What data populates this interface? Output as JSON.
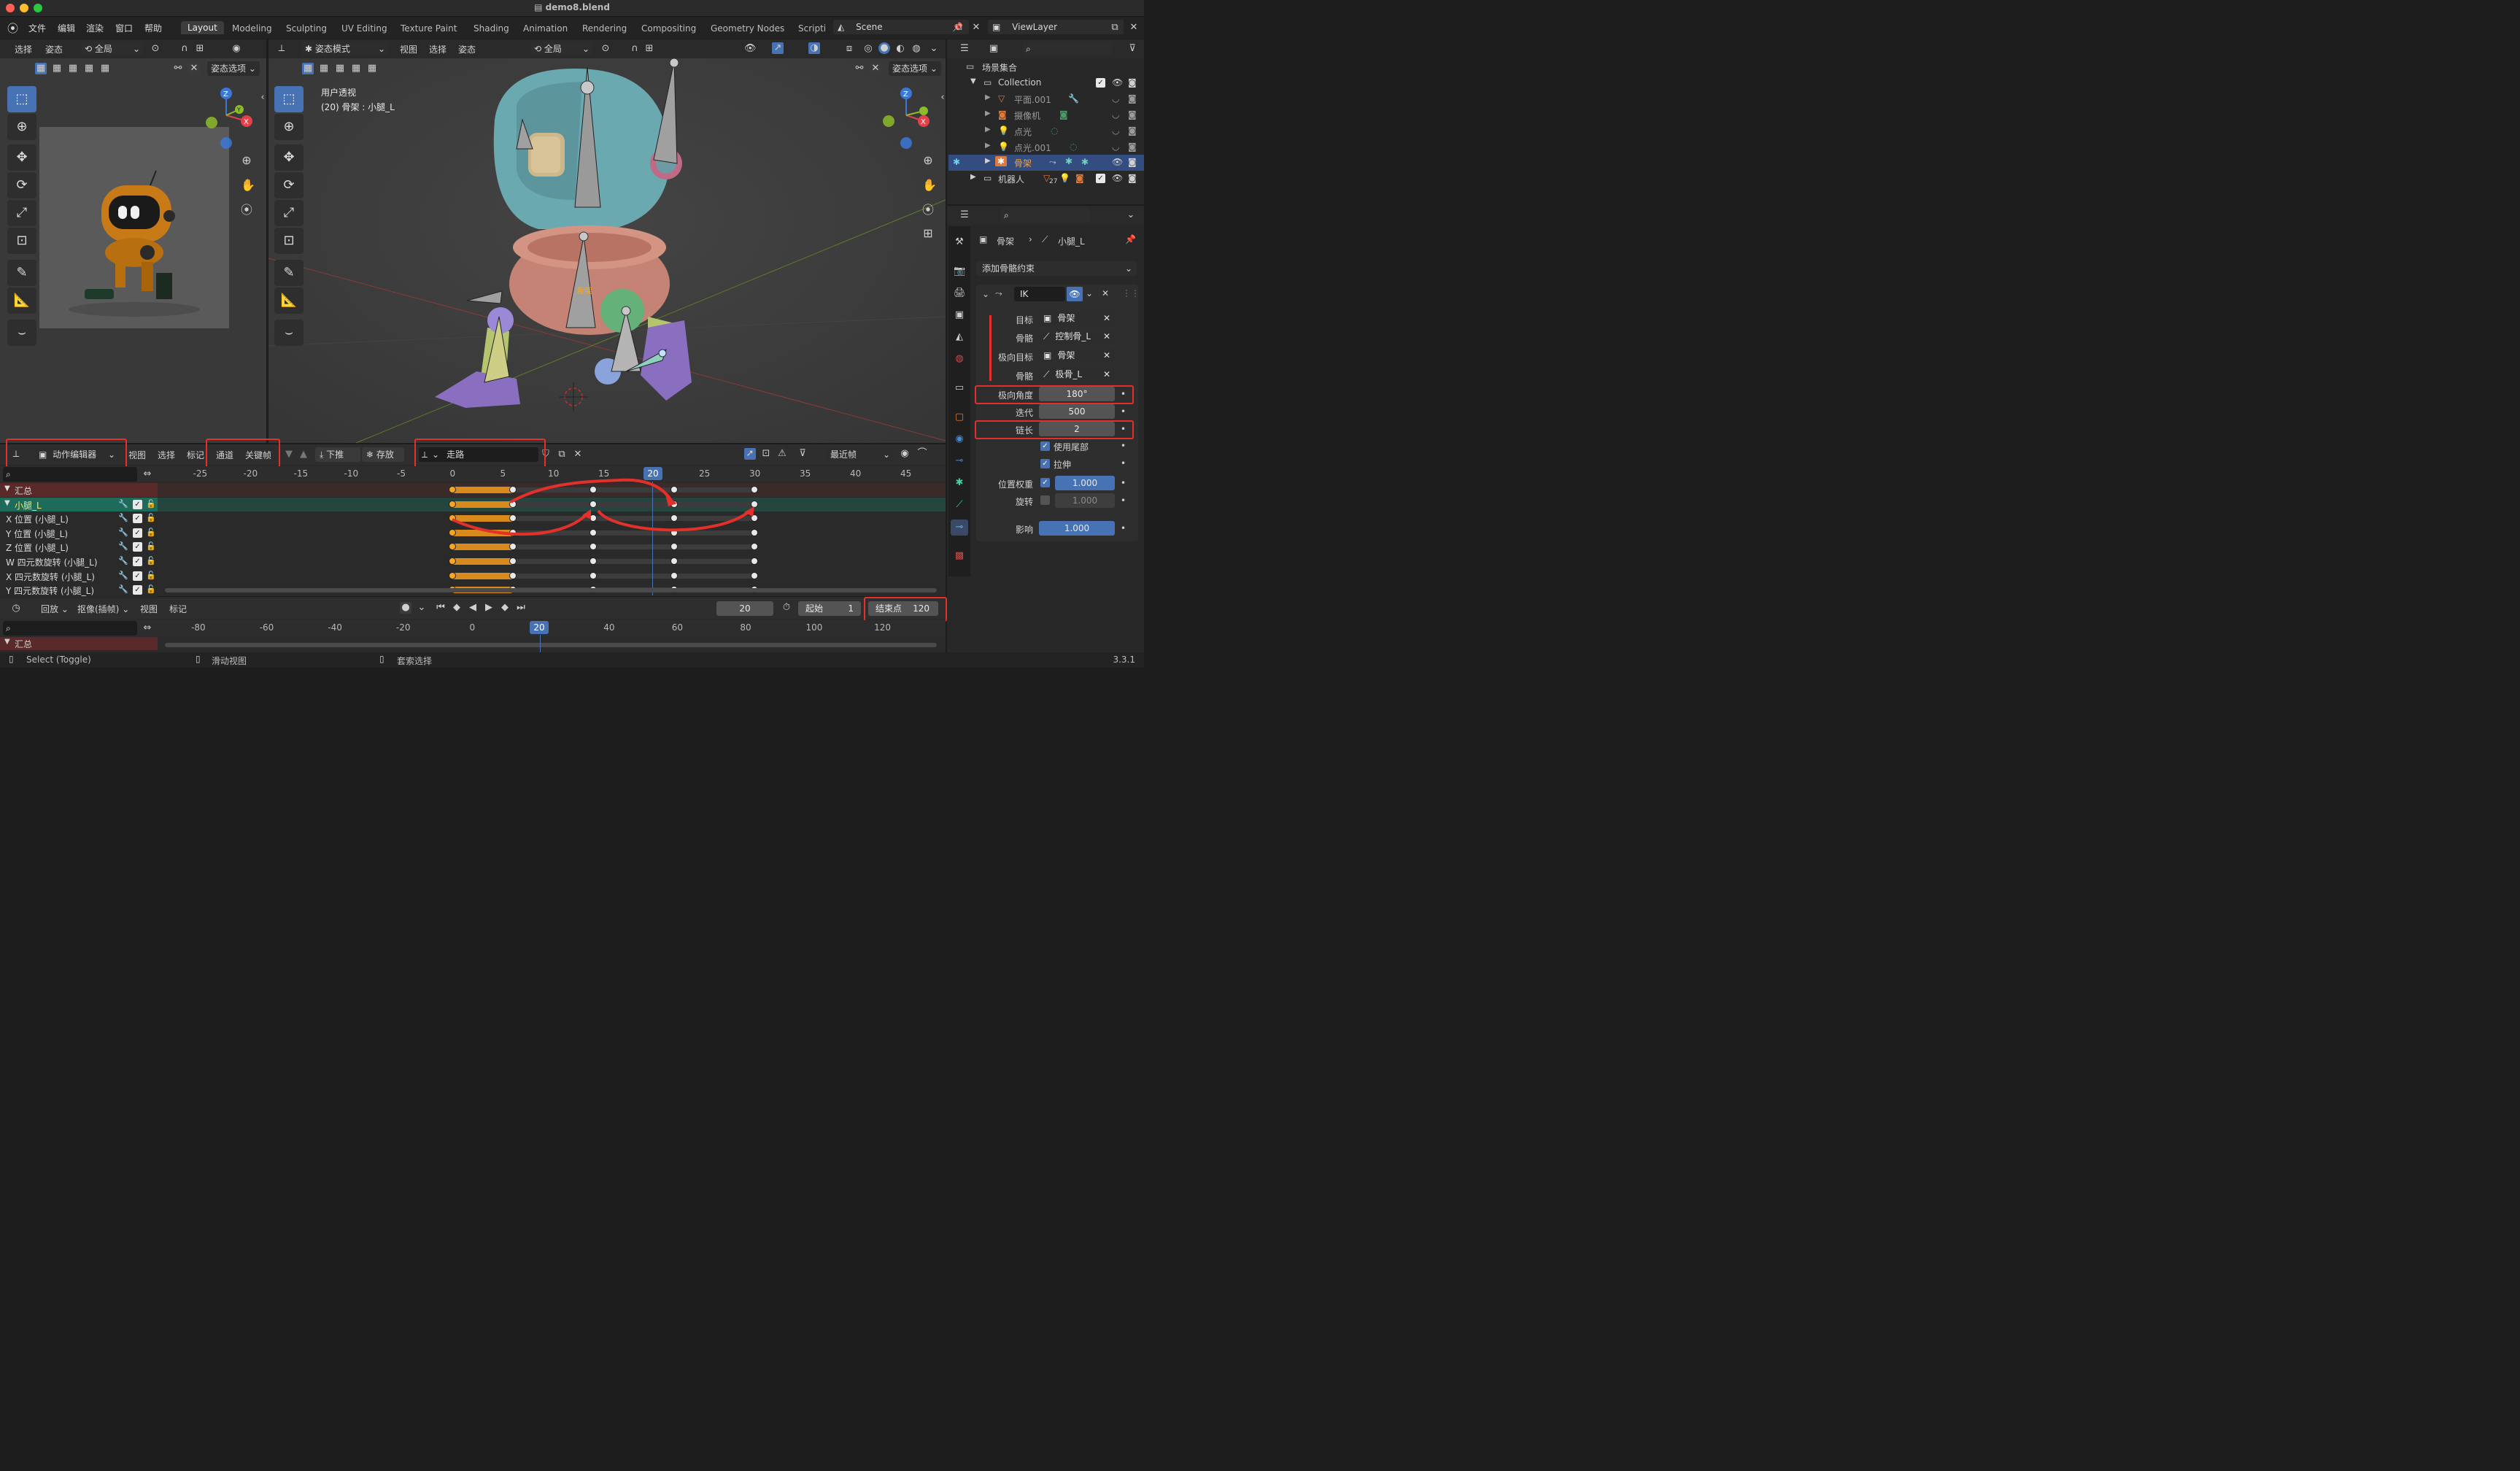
{
  "window": {
    "title": "demo8.blend",
    "version": "3.3.1"
  },
  "menu": {
    "items": [
      "文件",
      "编辑",
      "渲染",
      "窗口",
      "帮助"
    ]
  },
  "workspaces": [
    "Layout",
    "Modeling",
    "Sculpting",
    "UV Editing",
    "Texture Paint",
    "Shading",
    "Animation",
    "Rendering",
    "Compositing",
    "Geometry Nodes",
    "Scripti"
  ],
  "scene": {
    "name": "Scene",
    "view_layer": "ViewLayer"
  },
  "left_viewport": {
    "menus": [
      "选择",
      "姿态"
    ],
    "transform": "全局",
    "options": "姿态选项"
  },
  "main_viewport": {
    "mode": "姿态模式",
    "menus": [
      "视图",
      "选择",
      "姿态"
    ],
    "transform": "全局",
    "options": "姿态选项",
    "overlay_title": "用户透视",
    "overlay_subtitle": "(20) 骨架 : 小腿_L",
    "object_label": "骨架"
  },
  "outliner": {
    "root": "场景集合",
    "items": [
      {
        "name": "Collection",
        "level": 1
      },
      {
        "name": "平面.001",
        "level": 2
      },
      {
        "name": "摄像机",
        "level": 2
      },
      {
        "name": "点光",
        "level": 2
      },
      {
        "name": "点光.001",
        "level": 2
      },
      {
        "name": "骨架",
        "level": 2,
        "selected": true
      },
      {
        "name": "机器人",
        "level": 1,
        "badge": "27"
      }
    ]
  },
  "properties": {
    "breadcrumb_object": "骨架",
    "breadcrumb_bone": "小腿_L",
    "add_constraint": "添加骨骼约束",
    "constraint_name": "IK",
    "target_label": "目标",
    "target_value": "骨架",
    "bone_label": "骨骼",
    "bone_value": "控制骨_L",
    "pole_target_label": "极向目标",
    "pole_target_value": "骨架",
    "pole_bone_label": "骨骼",
    "pole_bone_value": "极骨_L",
    "pole_angle_label": "极向角度",
    "pole_angle_value": "180°",
    "iterations_label": "迭代",
    "iterations_value": "500",
    "chain_label": "链长",
    "chain_value": "2",
    "use_tail": "使用尾部",
    "stretch": "拉伸",
    "weight_pos_label": "位置权重",
    "weight_pos_value": "1.000",
    "rotation_label": "旋转",
    "rotation_value": "1.000",
    "influence_label": "影响",
    "influence_value": "1.000"
  },
  "dopesheet": {
    "mode": "动作编辑器",
    "menus": [
      "视图",
      "选择",
      "标记"
    ],
    "menus2": [
      "通道",
      "关键帧"
    ],
    "push_down": "下推",
    "stash": "存放",
    "action": "走路",
    "snap": "最近帧",
    "ruler": [
      "-25",
      "-20",
      "-15",
      "-10",
      "-5",
      "0",
      "5",
      "10",
      "15",
      "20",
      "25",
      "30",
      "35",
      "40",
      "45"
    ],
    "current_frame": "20",
    "channels": [
      "汇总",
      "小腿_L",
      "X 位置 (小腿_L)",
      "Y 位置 (小腿_L)",
      "Z 位置 (小腿_L)",
      "W 四元数旋转 (小腿_L)",
      "X 四元数旋转 (小腿_L)",
      "Y 四元数旋转 (小腿_L)"
    ],
    "keyframes": [
      0,
      6,
      14,
      22,
      30
    ]
  },
  "timeline": {
    "playback": "回放",
    "keying": "抠像(插帧)",
    "menus": [
      "视图",
      "标记"
    ],
    "current": "20",
    "start_label": "起始",
    "start": "1",
    "end_label": "结束点",
    "end": "120",
    "ruler": [
      "-80",
      "-60",
      "-40",
      "-20",
      "0",
      "20",
      "40",
      "60",
      "80",
      "100",
      "120"
    ],
    "summary": "汇总"
  },
  "statusbar": {
    "select": "Select (Toggle)",
    "pan": "滑动视图",
    "lasso": "套索选择"
  },
  "colors": {
    "accent": "#4772b3",
    "annotation": "#e3302a",
    "selected_row": "#1f6b5a",
    "keyframe": "#f5a623"
  }
}
